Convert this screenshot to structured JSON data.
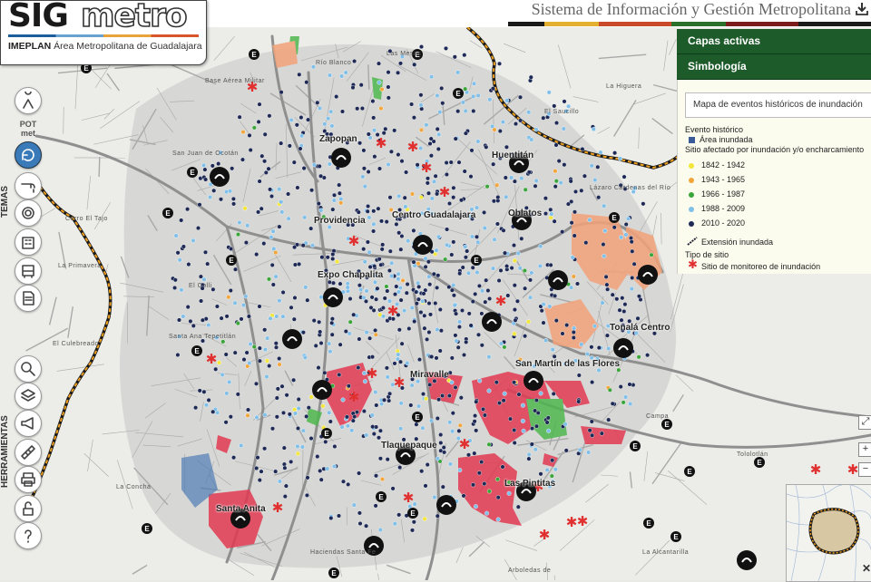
{
  "header": {
    "logo_sig": "SIG",
    "logo_metro": "metro",
    "logo_org": "IMEPLAN",
    "logo_sub": "Área Metropolitana de Guadalajara",
    "title": "Sistema de Información y Gestión Metropolitana"
  },
  "panels": {
    "active_layers": "Capas activas",
    "symbology": "Simbología"
  },
  "legend": {
    "map_select": "Mapa de eventos históricos de inundación",
    "event_heading": "Evento histórico",
    "flooded_area": "Área inundada",
    "site_affected": "Sitio afectado por inundación y/o encharcamiento",
    "periods": [
      {
        "label": "1842 - 1942",
        "color": "#f2e63a"
      },
      {
        "label": "1943 - 1965",
        "color": "#f2a53a"
      },
      {
        "label": "1966 - 1987",
        "color": "#3aa63a"
      },
      {
        "label": "1988 - 2009",
        "color": "#7fbfe8"
      },
      {
        "label": "2010 - 2020",
        "color": "#1e2a55"
      }
    ],
    "flooded_extent": "Extensión inundada",
    "site_type": "Tipo de sitio",
    "monitoring_site": "Sitio de monitoreo de inundación",
    "flood_area_color": "#3a5a9a",
    "monitor_color": "#e03030"
  },
  "sidebar": {
    "temas_label": "TEMAS",
    "herramientas_label": "HERRAMIENTAS",
    "potmet": "POT met",
    "icons": [
      "person-icon",
      "refresh-icon",
      "faucet-icon",
      "target-icon",
      "building-icon",
      "bus-icon",
      "document-icon",
      "zoom-icon",
      "layers-icon",
      "megaphone-icon",
      "ruler-icon",
      "print-icon",
      "unlock-icon",
      "help-icon"
    ]
  },
  "map": {
    "labels": [
      {
        "text": "Zapopan",
        "id": "zapopan"
      },
      {
        "text": "Providencia",
        "id": "providencia"
      },
      {
        "text": "Centro Guadalajara",
        "id": "centro"
      },
      {
        "text": "Expo Chapalita",
        "id": "expo"
      },
      {
        "text": "Huentitán",
        "id": "huentitan"
      },
      {
        "text": "Oblatos",
        "id": "oblatos"
      },
      {
        "text": "Tonalá Centro",
        "id": "tonala"
      },
      {
        "text": "San Martín de las Flores",
        "id": "sanmartin"
      },
      {
        "text": "Miravalle",
        "id": "miravalle"
      },
      {
        "text": "Tlaquepaque",
        "id": "tlaquepaque"
      },
      {
        "text": "Las Pintitas",
        "id": "pintitas"
      },
      {
        "text": "Santa Anita",
        "id": "santaanita"
      }
    ],
    "minor_labels": [
      "Río Blanco",
      "Las Mesas",
      "Base Aérea Militar",
      "San Juan de Ocotán",
      "Santa Ana Tepetitlán",
      "El Colli",
      "El Culebreado",
      "La Primavera",
      "Cerro El Tajo",
      "La Concha",
      "Haciendas Santa Fe",
      "Arboledas de",
      "Lázaro Cárdenas del Río",
      "La Higuera",
      "El Saucillo",
      "Tololotlán",
      "La Alcantarilla",
      "Campa"
    ],
    "zoom_in": "+",
    "zoom_out": "−"
  }
}
